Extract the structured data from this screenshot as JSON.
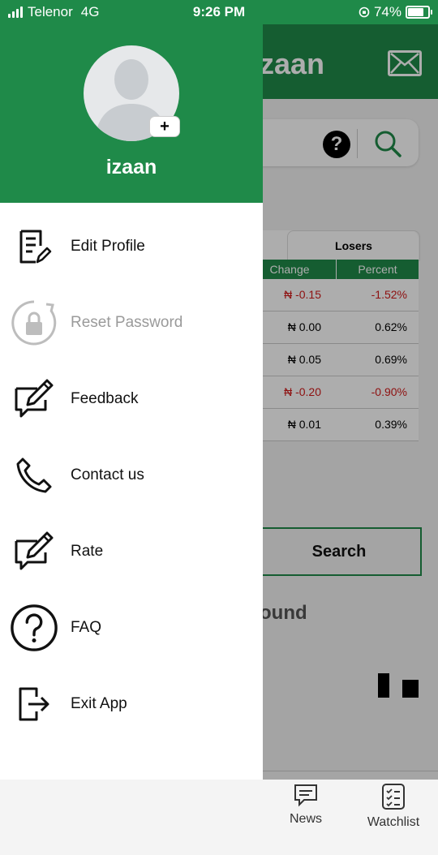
{
  "status_bar": {
    "carrier": "Telenor",
    "network": "4G",
    "time": "9:26 PM",
    "battery": "74%"
  },
  "background_app": {
    "title_fragment": "zaan",
    "help_symbol": "?",
    "table": {
      "tab_label": "Losers",
      "columns": [
        "Change",
        "Percent"
      ],
      "rows": [
        {
          "change": "₦ -0.15",
          "percent": "-1.52%",
          "negative": true
        },
        {
          "change": "₦ 0.00",
          "percent": "0.62%",
          "negative": false
        },
        {
          "change": "₦ 0.05",
          "percent": "0.69%",
          "negative": false
        },
        {
          "change": "₦ -0.20",
          "percent": "-0.90%",
          "negative": true
        },
        {
          "change": "₦ 0.01",
          "percent": "0.39%",
          "negative": false
        }
      ]
    },
    "search_button": "Search",
    "partial_text": "ound",
    "tabs": [
      {
        "label": "News",
        "icon": "news-icon"
      },
      {
        "label": "Watchlist",
        "icon": "watchlist-icon"
      }
    ]
  },
  "drawer": {
    "username": "izaan",
    "add_photo_symbol": "+",
    "menu": [
      {
        "label": "Edit Profile",
        "icon": "edit-profile-icon",
        "enabled": true
      },
      {
        "label": "Reset Password",
        "icon": "reset-password-icon",
        "enabled": false
      },
      {
        "label": "Feedback",
        "icon": "feedback-icon",
        "enabled": true
      },
      {
        "label": "Contact us",
        "icon": "phone-icon",
        "enabled": true
      },
      {
        "label": "Rate",
        "icon": "rate-icon",
        "enabled": true
      },
      {
        "label": "FAQ",
        "icon": "faq-icon",
        "enabled": true
      },
      {
        "label": "Exit App",
        "icon": "exit-icon",
        "enabled": true
      }
    ]
  },
  "colors": {
    "brand_green": "#1f8a49",
    "negative_red": "#d21a1a",
    "disabled_gray": "#9a9a9a"
  }
}
